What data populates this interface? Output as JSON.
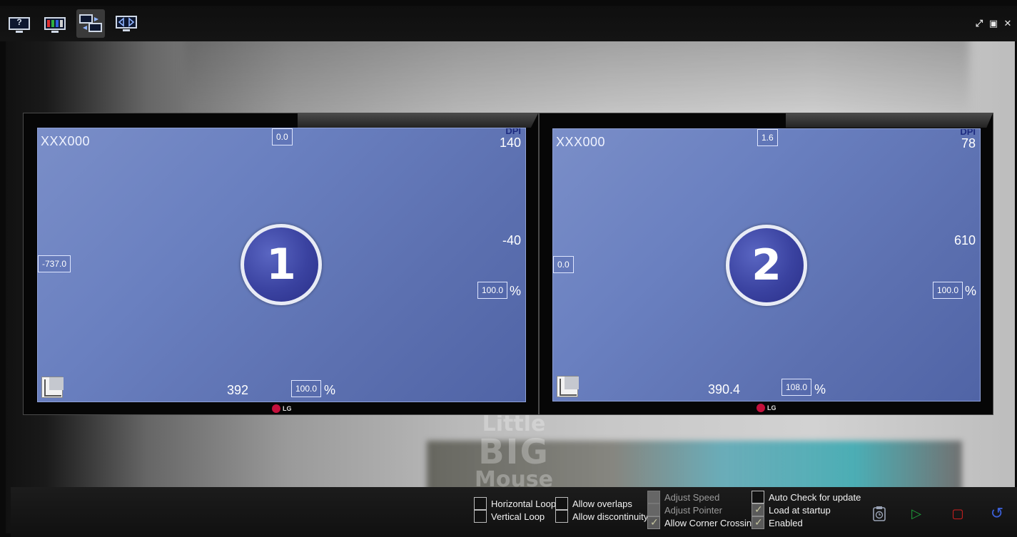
{
  "toolbar": {
    "buttons": [
      {
        "name": "help",
        "icon": "help-monitor-icon",
        "glyph": "?"
      },
      {
        "name": "colors",
        "icon": "color-bars-monitor-icon"
      },
      {
        "name": "layout",
        "icon": "multi-monitor-icon",
        "active": true
      },
      {
        "name": "arrange",
        "icon": "arrows-monitor-icon"
      }
    ],
    "window_controls": {
      "pin": "⤢",
      "maximize": "▣",
      "close": "✕"
    }
  },
  "watermark": {
    "line1": "Little",
    "line2": "BIG",
    "line3": "Mouse"
  },
  "monitors": [
    {
      "id": "1",
      "name": "XXX000",
      "dpi_label": "DPI",
      "dpi": "140",
      "top_offset": "0.0",
      "left_offset": "-737.0",
      "right_value": "-40",
      "scale_right": "100.0",
      "bottom_value": "392",
      "scale_bottom": "100.0",
      "pct": "%",
      "brand": "LG"
    },
    {
      "id": "2",
      "name": "XXX000",
      "dpi_label": "DPI",
      "dpi": "78",
      "top_offset": "1.6",
      "left_offset": "0.0",
      "right_value": "610",
      "scale_right": "100.0",
      "bottom_value": "390.4",
      "scale_bottom": "108.0",
      "pct": "%",
      "brand": "LG"
    }
  ],
  "options": {
    "horizontal_loop": {
      "label": "Horizontal Loop",
      "checked": false
    },
    "vertical_loop": {
      "label": "Vertical Loop",
      "checked": false
    },
    "allow_overlaps": {
      "label": "Allow overlaps",
      "checked": false
    },
    "allow_discontinuity": {
      "label": "Allow discontinuity",
      "checked": false
    },
    "adjust_speed": {
      "label": "Adjust Speed",
      "checked": false,
      "disabled": true
    },
    "adjust_pointer": {
      "label": "Adjust Pointer",
      "checked": false,
      "disabled": true
    },
    "allow_corner_crossing": {
      "label": "Allow Corner Crossing",
      "checked": true
    },
    "auto_check_update": {
      "label": "Auto Check for update",
      "checked": false
    },
    "load_at_startup": {
      "label": "Load at startup",
      "checked": true
    },
    "enabled": {
      "label": "Enabled",
      "checked": true
    }
  },
  "actions": {
    "schedule": {
      "icon": "clock-clipboard-icon"
    },
    "start": {
      "icon": "play-icon",
      "glyph": "▷",
      "color": "#1f9e3a"
    },
    "stop": {
      "icon": "stop-icon",
      "glyph": "▢",
      "color": "#d02020"
    },
    "reload": {
      "icon": "reload-icon",
      "glyph": "↺",
      "color": "#3b5fd6"
    }
  },
  "colors": {
    "screen": "#6a80c0",
    "badge": "#3a42a0",
    "dpi_label": "#1d2b80"
  }
}
